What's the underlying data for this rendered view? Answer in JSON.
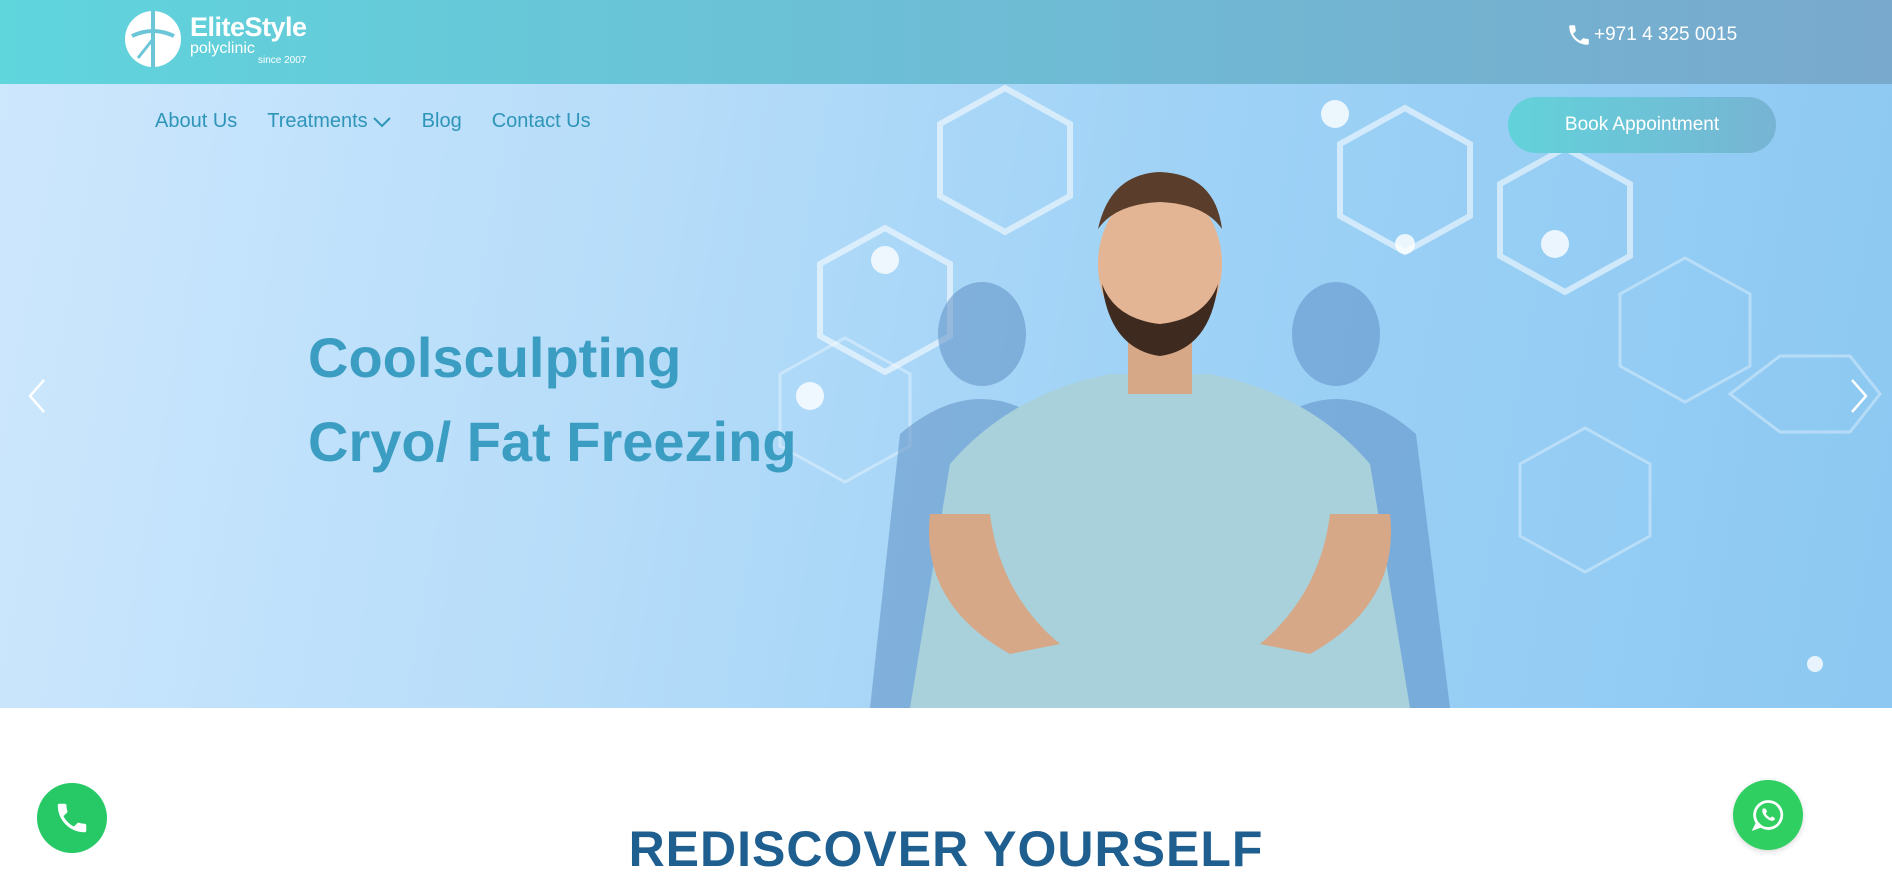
{
  "header": {
    "logo": {
      "name": "EliteStyle",
      "sub": "polyclinic",
      "since": "since 2007"
    },
    "phone": {
      "icon": "phone-icon",
      "number": "+971 4 325 0015"
    }
  },
  "nav": {
    "items": [
      {
        "label": "About Us"
      },
      {
        "label": "Treatments",
        "icon": "chevron-down-icon"
      },
      {
        "label": "Blog"
      },
      {
        "label": "Contact Us"
      }
    ],
    "book_button": "Book Appointment"
  },
  "hero": {
    "line1": "Coolsculpting",
    "line2": "Cryo/ Fat Freezing",
    "prev_icon": "chevron-left-icon",
    "next_icon": "chevron-right-icon"
  },
  "section": {
    "title": "REDISCOVER YOURSELF"
  },
  "floating": {
    "call_icon": "phone-icon",
    "whatsapp_icon": "whatsapp-icon"
  },
  "colors": {
    "brand_teal": "#5fd5dc",
    "nav_text": "#2e95b9",
    "headline": "#3b9dc2",
    "section_title": "#1f5f8f",
    "float_green": "#26c965"
  }
}
